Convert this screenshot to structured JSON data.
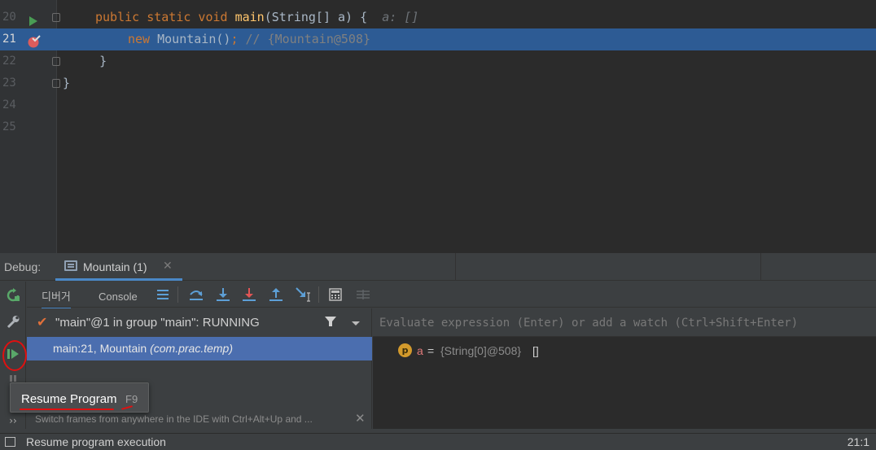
{
  "editor": {
    "lines": [
      {
        "num": "20",
        "kw1": "public static void ",
        "fn": "main",
        "rest": "(String[] a) {",
        "hint": "a: []"
      },
      {
        "num": "21",
        "kw": "new ",
        "text": "Mountain()",
        "kw2": ";",
        "comment": " // {Mountain@508}"
      },
      {
        "num": "22",
        "text": "    }"
      },
      {
        "num": "23",
        "text": "}"
      },
      {
        "num": "24"
      },
      {
        "num": "25"
      }
    ]
  },
  "debug": {
    "label": "Debug:",
    "session_tab": "Mountain (1)",
    "tabs": {
      "debugger": "디버거",
      "console": "Console"
    },
    "thread": "\"main\"@1 in group \"main\": RUNNING",
    "frame": {
      "location": "main:21, Mountain",
      "package": "(com.prac.temp)"
    },
    "hint": "Switch frames from anywhere in the IDE with Ctrl+Alt+Up and ...",
    "evaluate_placeholder": "Evaluate expression (Enter) or add a watch (Ctrl+Shift+Enter)",
    "variable": {
      "badge": "p",
      "name": "a",
      "eq": " = ",
      "value": "{String[0]@508}",
      "extra": "[]"
    }
  },
  "tooltip": {
    "label": "Resume Program",
    "shortcut": "F9"
  },
  "statusbar": {
    "message": "Resume program execution",
    "position": "21:1"
  },
  "icons": {
    "run_gutter": "run-arrow-icon",
    "breakpoint": "breakpoint-icon",
    "rerun": "rerun-icon",
    "settings": "wrench-icon",
    "resume": "resume-program-icon",
    "filter": "filter-icon"
  },
  "colors": {
    "accent": "#4a88c7",
    "selection": "#2d5b94",
    "annotation": "#e01010"
  }
}
